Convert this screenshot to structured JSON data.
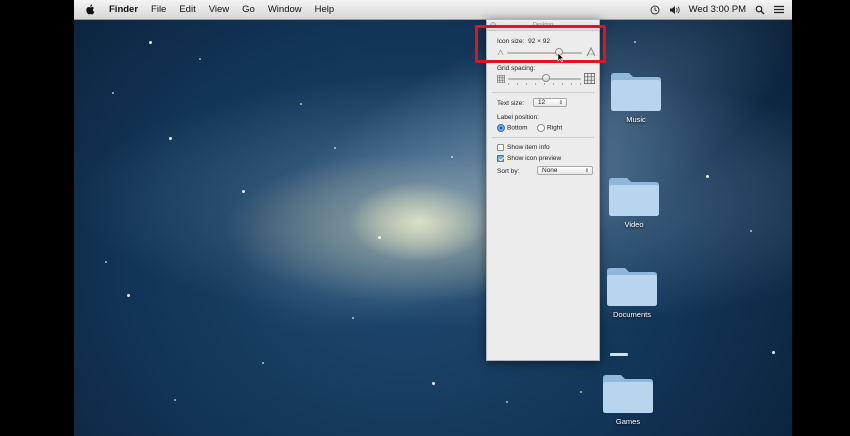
{
  "menubar": {
    "items": [
      {
        "label": "Finder",
        "bold": true
      },
      {
        "label": "File"
      },
      {
        "label": "Edit"
      },
      {
        "label": "View"
      },
      {
        "label": "Go"
      },
      {
        "label": "Window"
      },
      {
        "label": "Help"
      }
    ],
    "right": {
      "icons": [
        "time-machine-icon",
        "volume-icon"
      ],
      "clock": "Wed 3:00 PM",
      "extra_icons": [
        "spotlight-icon",
        "list-icon"
      ]
    }
  },
  "view_options": {
    "title": "Desktop",
    "icon_size_label": "Icon size:",
    "icon_size_value": "92 × 92",
    "icon_size_level": 0.72,
    "grid_spacing_label": "Grid spacing:",
    "grid_spacing_level": 0.52,
    "text_size_label": "Text size:",
    "text_size_value": "12",
    "label_position_label": "Label position:",
    "label_position_options": [
      "Bottom",
      "Right"
    ],
    "label_position_selected": "Bottom",
    "show_item_info_label": "Show item info",
    "show_item_info_checked": false,
    "show_icon_preview_label": "Show icon preview",
    "show_icon_preview_checked": true,
    "sort_by_label": "Sort by:",
    "sort_by_value": "None"
  },
  "desktop": {
    "folders": [
      {
        "label": "Music"
      },
      {
        "label": "Video"
      },
      {
        "label": "Documents"
      },
      {
        "label": ""
      },
      {
        "label": "Games"
      }
    ]
  },
  "colors": {
    "highlight": "#e0141f",
    "folder": "#a9cbe8"
  }
}
